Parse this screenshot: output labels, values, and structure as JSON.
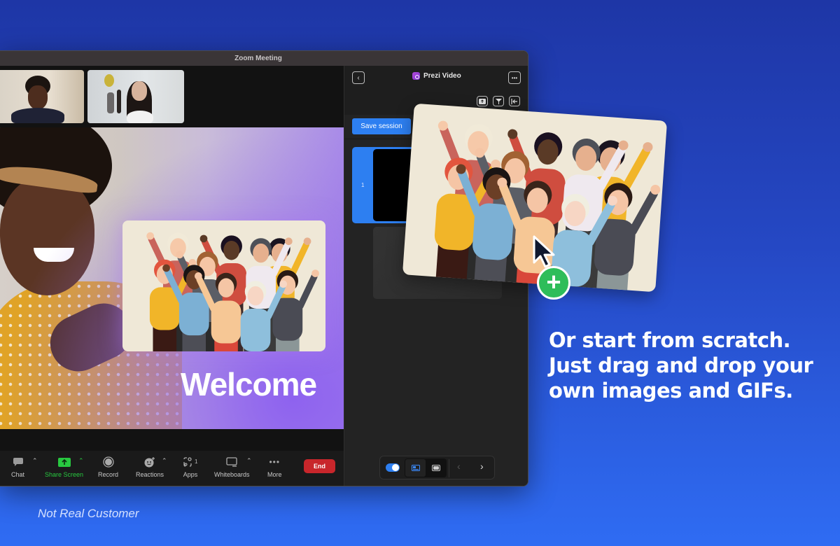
{
  "window": {
    "title": "Zoom Meeting"
  },
  "meeting": {
    "participants": [
      {
        "label": "participant-1"
      },
      {
        "label": "participant-2"
      }
    ],
    "slide_title": "Welcome"
  },
  "toolbar": {
    "items": [
      {
        "label": "Chat",
        "icon": "chat-icon",
        "has_caret": true
      },
      {
        "label": "Share Screen",
        "icon": "share-screen-icon",
        "has_caret": true
      },
      {
        "label": "Record",
        "icon": "record-icon",
        "has_caret": false
      },
      {
        "label": "Reactions",
        "icon": "reactions-icon",
        "has_caret": true
      },
      {
        "label": "Apps",
        "icon": "apps-icon",
        "badge": "1"
      },
      {
        "label": "Whiteboards",
        "icon": "whiteboard-icon",
        "has_caret": true
      },
      {
        "label": "More",
        "icon": "more-icon",
        "has_caret": false
      }
    ],
    "end_label": "End",
    "colors": {
      "share": "#28c840",
      "end": "#c8262b"
    }
  },
  "panel": {
    "title": "Prezi Video",
    "save_label": "Save session",
    "slides": [
      {
        "number": "1"
      }
    ],
    "colors": {
      "accent": "#2d7ff1"
    }
  },
  "marketing": {
    "headline_lines": [
      "Or start from scratch.",
      "Just drag and drop your",
      "own images and GIFs."
    ],
    "disclaimer": "Not Real Customer"
  }
}
